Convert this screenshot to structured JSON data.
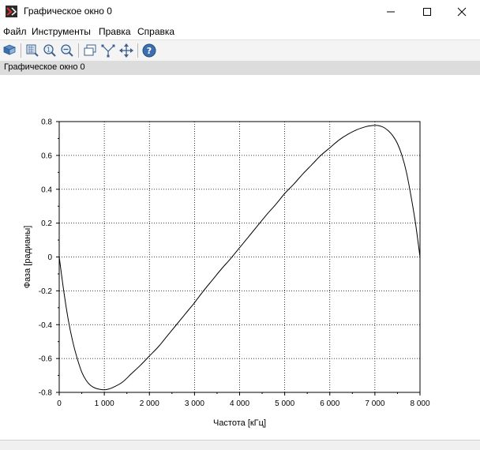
{
  "window": {
    "title": "Графическое окно 0",
    "app_icon": "scilab-icon",
    "controls": [
      "minimize-icon",
      "maximize-icon",
      "close-icon"
    ]
  },
  "menu": {
    "items": [
      "Файл",
      "Инструменты",
      "Правка",
      "Справка"
    ]
  },
  "toolbar": {
    "buttons": [
      "rotate-icon",
      "zoom-in-icon",
      "zoom-original-icon",
      "zoom-out-icon",
      "figure-icon",
      "datatip-icon",
      "pan-icon",
      "help-icon"
    ]
  },
  "label_strip": {
    "text": "Графическое окно 0"
  },
  "colors": {
    "gridline": "#000000",
    "curve": "#000000",
    "label_strip_bg": "#dcdcdc"
  },
  "chart_data": {
    "type": "line",
    "title": "",
    "xlabel": "Частота [кГц]",
    "ylabel": "Фаза [радианы]",
    "xlim": [
      0,
      8000
    ],
    "ylim": [
      -0.8,
      0.8
    ],
    "xticks": [
      0,
      1000,
      2000,
      3000,
      4000,
      5000,
      6000,
      7000,
      8000
    ],
    "xtick_labels": [
      "0",
      "1 000",
      "2 000",
      "3 000",
      "4 000",
      "5 000",
      "6 000",
      "7 000",
      "8 000"
    ],
    "yticks": [
      -0.8,
      -0.6,
      -0.4,
      -0.2,
      0,
      0.2,
      0.4,
      0.6,
      0.8
    ],
    "ytick_labels": [
      "-0.8",
      "-0.6",
      "-0.4",
      "-0.2",
      "0",
      "0.2",
      "0.4",
      "0.6",
      "0.8"
    ],
    "grid": "dotted",
    "series": [
      {
        "x": [
          0,
          100,
          200,
          300,
          400,
          500,
          600,
          700,
          800,
          900,
          1000,
          1100,
          1200,
          1400,
          1600,
          1800,
          2000,
          2200,
          2400,
          2600,
          2800,
          3000,
          3200,
          3400,
          3600,
          3800,
          4000,
          4200,
          4400,
          4600,
          4800,
          5000,
          5200,
          5400,
          5600,
          5800,
          6000,
          6200,
          6400,
          6600,
          6800,
          6900,
          7000,
          7100,
          7200,
          7300,
          7400,
          7500,
          7600,
          7700,
          7800,
          7900,
          8000
        ],
        "y": [
          0,
          -0.2,
          -0.37,
          -0.5,
          -0.6,
          -0.68,
          -0.73,
          -0.76,
          -0.775,
          -0.782,
          -0.785,
          -0.78,
          -0.77,
          -0.74,
          -0.69,
          -0.64,
          -0.585,
          -0.53,
          -0.465,
          -0.4,
          -0.335,
          -0.27,
          -0.2,
          -0.135,
          -0.07,
          -0.01,
          0.055,
          0.12,
          0.185,
          0.25,
          0.31,
          0.375,
          0.43,
          0.49,
          0.545,
          0.6,
          0.645,
          0.69,
          0.725,
          0.752,
          0.77,
          0.775,
          0.778,
          0.775,
          0.765,
          0.745,
          0.715,
          0.67,
          0.6,
          0.5,
          0.36,
          0.2,
          0
        ]
      }
    ]
  }
}
